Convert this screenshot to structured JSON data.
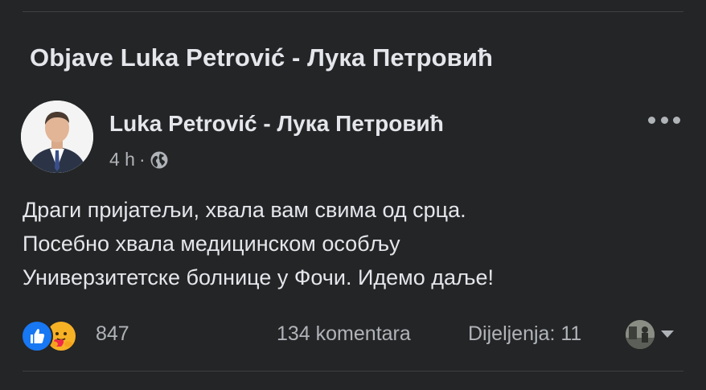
{
  "section": {
    "title": "Objave Luka Petrović - Лука Петровић"
  },
  "post": {
    "author": "Luka Petrović - Лука Петровић",
    "time": "4 h",
    "separator": "·",
    "privacy_icon": "globe-icon",
    "more_icon": "more-options-icon",
    "body_lines": [
      "Драги пријатељи, хвала вам свима од срца.",
      "Посебно хвала медицинском особљу",
      "Универзитетске болнице у Фочи. Идемо даље!"
    ]
  },
  "footer": {
    "reactions": [
      "like-reaction-icon",
      "care-reaction-icon"
    ],
    "reaction_count": "847",
    "comments": "134 komentara",
    "shares": "Dijeljenja: 11"
  },
  "colors": {
    "background": "#242526",
    "primary_text": "#e4e6eb",
    "secondary_text": "#b0b3b8",
    "like_blue": "#1877f2",
    "care_yellow": "#f7b125",
    "divider": "#3e4042"
  }
}
